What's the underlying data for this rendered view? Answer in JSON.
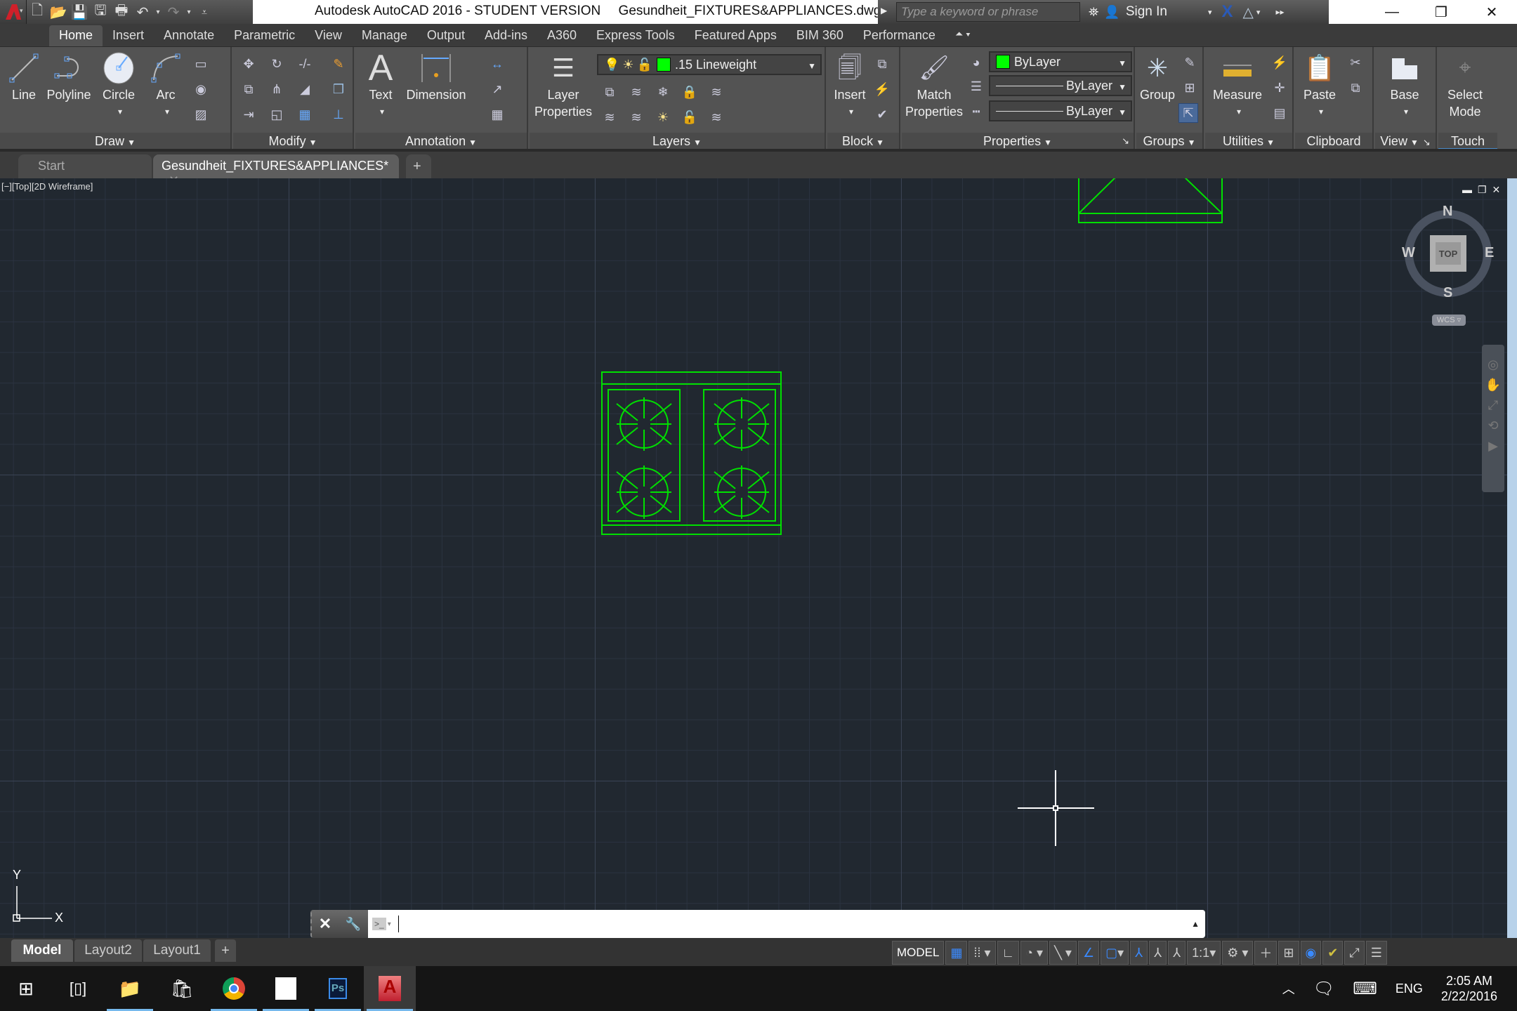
{
  "window": {
    "app_title": "Autodesk AutoCAD 2016 - STUDENT VERSION",
    "file_title": "Gesundheit_FIXTURES&APPLIANCES.dwg",
    "search_placeholder": "Type a keyword or phrase",
    "sign_in": "Sign In"
  },
  "ribbon_tabs": [
    "Home",
    "Insert",
    "Annotate",
    "Parametric",
    "View",
    "Manage",
    "Output",
    "Add-ins",
    "A360",
    "Express Tools",
    "Featured Apps",
    "BIM 360",
    "Performance"
  ],
  "panels": {
    "draw": {
      "title": "Draw",
      "buttons": [
        "Line",
        "Polyline",
        "Circle",
        "Arc"
      ]
    },
    "modify": {
      "title": "Modify"
    },
    "annotation": {
      "title": "Annotation",
      "buttons": [
        "Text",
        "Dimension"
      ]
    },
    "layers": {
      "title": "Layers",
      "button": "Layer",
      "button2": "Properties",
      "current_layer": ".15 Lineweight"
    },
    "block": {
      "title": "Block",
      "button": "Insert"
    },
    "properties": {
      "title": "Properties",
      "button": "Match",
      "button2": "Properties",
      "color": "ByLayer",
      "linetype": "ByLayer",
      "lineweight": "ByLayer"
    },
    "groups": {
      "title": "Groups",
      "button": "Group"
    },
    "utilities": {
      "title": "Utilities",
      "button": "Measure"
    },
    "clipboard": {
      "title": "Clipboard",
      "button": "Paste"
    },
    "view": {
      "title": "View",
      "button": "Base"
    },
    "touch": {
      "title": "Touch",
      "button": "Select",
      "button2": "Mode"
    }
  },
  "file_tabs": {
    "start": "Start",
    "active": "Gesundheit_FIXTURES&APPLIANCES*"
  },
  "viewport": {
    "label": "[−][Top][2D Wireframe]",
    "viewcube": {
      "face": "TOP",
      "n": "N",
      "s": "S",
      "e": "E",
      "w": "W",
      "ucs": "WCS"
    },
    "ucs_x": "X",
    "ucs_y": "Y",
    "line_color": "#00e000"
  },
  "layout_tabs": [
    "Model",
    "Layout2",
    "Layout1"
  ],
  "status": {
    "model": "MODEL",
    "scale": "1:1"
  },
  "taskbar": {
    "time": "2:05 AM",
    "date": "2/22/2016",
    "lang": "ENG"
  }
}
